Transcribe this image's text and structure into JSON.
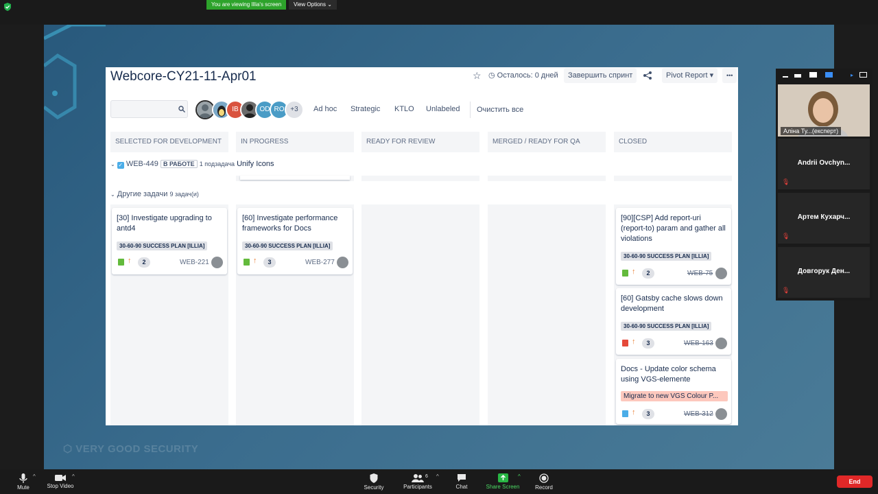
{
  "meeting": {
    "banner": "You are viewing Illia's screen",
    "view_options": "View Options",
    "watermark": "VERY GOOD SECURITY"
  },
  "board": {
    "title": "Webcore-CY21-11-Apr01",
    "remaining": "Осталось: 0 дней",
    "complete_sprint": "Завершить спринт",
    "report": "Pivot Report",
    "more": "•••",
    "avatars": [
      {
        "text": "",
        "color": "#5f6b73"
      },
      {
        "text": "",
        "color": "#d9c49a"
      },
      {
        "text": "IB",
        "color": "#d9533f"
      },
      {
        "text": "",
        "color": "#3b3b3b"
      },
      {
        "text": "OD",
        "color": "#4a9cc6"
      },
      {
        "text": "RO",
        "color": "#4a9cc6"
      },
      {
        "text": "+3",
        "color": "#dfe1e6"
      }
    ],
    "filters": [
      "Ad hoc",
      "Strategic",
      "KTLO",
      "Unlabeled"
    ],
    "clear": "Очистить все",
    "columns": [
      "SELECTED FOR DEVELOPMENT",
      "IN PROGRESS",
      "READY FOR REVIEW",
      "MERGED / READY FOR QA",
      "CLOSED"
    ],
    "swimlane1": {
      "key": "WEB-449",
      "status": "В РАБОТЕ",
      "subtasks": "1 подзадача",
      "summary": "Unify Icons"
    },
    "swimlane2": {
      "label": "Другие задачи",
      "count": "9 задач(и)"
    },
    "cards": {
      "c1": {
        "title": "[30] Investigate upgrading to antd4",
        "epic": "30-60-90 SUCCESS PLAN [ILLIA]",
        "points": "2",
        "key": "WEB-221"
      },
      "c2": {
        "title": "[60] Investigate performance frameworks for Docs",
        "epic": "30-60-90 SUCCESS PLAN [ILLIA]",
        "points": "3",
        "key": "WEB-277"
      },
      "c3": {
        "title": "[90][CSP] Add report-uri (report-to) param and gather all violations",
        "epic": "30-60-90 SUCCESS PLAN [ILLIA]",
        "points": "2",
        "key": "WEB-75"
      },
      "c4": {
        "title": "[60] Gatsby cache slows down development",
        "epic": "30-60-90 SUCCESS PLAN [ILLIA]",
        "points": "3",
        "key": "WEB-163"
      },
      "c5": {
        "title": "Docs - Update color schema using VGS-elemente",
        "epic": "Migrate to new VGS Colour P...",
        "points": "3",
        "key": "WEB-312"
      }
    }
  },
  "participants": [
    {
      "name": "Аліна Ту...(експерт)"
    },
    {
      "name": "Andrii Ovchyn..."
    },
    {
      "name": "Артем Кухарч..."
    },
    {
      "name": "Довгорук Ден..."
    }
  ],
  "toolbar": {
    "mute": "Mute",
    "stop_video": "Stop Video",
    "security": "Security",
    "participants": "Participants",
    "participants_count": "6",
    "chat": "Chat",
    "share_screen": "Share Screen",
    "record": "Record",
    "end": "End"
  }
}
